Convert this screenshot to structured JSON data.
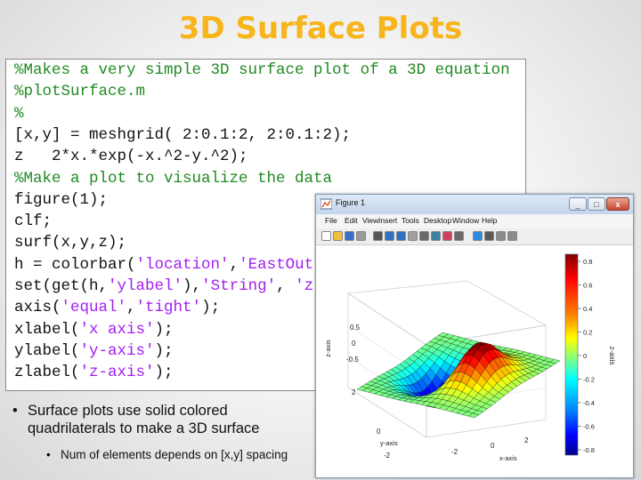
{
  "slide": {
    "title": "3D Surface Plots",
    "code_lines": [
      {
        "parts": [
          {
            "t": "%Makes a very simple 3D surface plot of a 3D equation",
            "c": "comment"
          }
        ]
      },
      {
        "parts": [
          {
            "t": "%plotSurface.m",
            "c": "comment"
          }
        ]
      },
      {
        "parts": [
          {
            "t": "%",
            "c": "comment"
          }
        ]
      },
      {
        "parts": [
          {
            "t": "[x,y] = meshgrid( 2:0.1:2, 2:0.1:2);",
            "c": "code"
          }
        ]
      },
      {
        "parts": [
          {
            "t": "z   2*x.*exp(-x.^2-y.^2);",
            "c": "code"
          }
        ]
      },
      {
        "parts": [
          {
            "t": "%Make a plot to visualize the data",
            "c": "comment"
          }
        ]
      },
      {
        "parts": [
          {
            "t": "figure(1);",
            "c": "code"
          }
        ]
      },
      {
        "parts": [
          {
            "t": "clf;",
            "c": "code"
          }
        ]
      },
      {
        "parts": [
          {
            "t": "surf(x,y,z);",
            "c": "code"
          }
        ]
      },
      {
        "parts": [
          {
            "t": "h = colorbar(",
            "c": "code"
          },
          {
            "t": "'location'",
            "c": "string"
          },
          {
            "t": ",",
            "c": "code"
          },
          {
            "t": "'EastOut",
            "c": "string"
          }
        ]
      },
      {
        "parts": [
          {
            "t": "set(get(h,",
            "c": "code"
          },
          {
            "t": "'ylabel'",
            "c": "string"
          },
          {
            "t": "),",
            "c": "code"
          },
          {
            "t": "'String'",
            "c": "string"
          },
          {
            "t": ", ",
            "c": "code"
          },
          {
            "t": "'z",
            "c": "string"
          }
        ]
      },
      {
        "parts": [
          {
            "t": "axis(",
            "c": "code"
          },
          {
            "t": "'equal'",
            "c": "string"
          },
          {
            "t": ",",
            "c": "code"
          },
          {
            "t": "'tight'",
            "c": "string"
          },
          {
            "t": ");",
            "c": "code"
          }
        ]
      },
      {
        "parts": [
          {
            "t": "xlabel(",
            "c": "code"
          },
          {
            "t": "'x axis'",
            "c": "string"
          },
          {
            "t": ");",
            "c": "code"
          }
        ]
      },
      {
        "parts": [
          {
            "t": "ylabel(",
            "c": "code"
          },
          {
            "t": "'y-axis'",
            "c": "string"
          },
          {
            "t": ");",
            "c": "code"
          }
        ]
      },
      {
        "parts": [
          {
            "t": "zlabel(",
            "c": "code"
          },
          {
            "t": "'z-axis'",
            "c": "string"
          },
          {
            "t": ");",
            "c": "code"
          }
        ]
      }
    ],
    "bullet_1": "Surface plots use solid colored quadrilaterals to make a 3D surface",
    "bullet_2": "Num of elements depends on [x,y] spacing",
    "bullet_symbol": "•"
  },
  "figure_window": {
    "title": "Figure 1",
    "minimize": "_",
    "maximize": "□",
    "close": "x",
    "menus": [
      "File",
      "Edit",
      "View",
      "Insert",
      "Tools",
      "Desktop",
      "Window",
      "Help"
    ],
    "tool_icons": [
      "new-file-icon",
      "open-file-icon",
      "save-icon",
      "print-icon",
      "pointer-icon",
      "zoom-in-icon",
      "zoom-out-icon",
      "pan-icon",
      "rotate-icon",
      "data-cursor-icon",
      "brush-icon",
      "link-icon",
      "colorbar-icon",
      "legend-icon",
      "hide-plot-tools-icon",
      "show-plot-tools-icon"
    ],
    "colorbar": {
      "ticks": [
        "0.8",
        "0.6",
        "0.4",
        "0.2",
        "0",
        "-0.2",
        "-0.4",
        "-0.6",
        "-0.8"
      ],
      "label": "z-axis",
      "colors": [
        "#7f0000",
        "#ff0000",
        "#ff8000",
        "#ffff00",
        "#80ff80",
        "#00ffff",
        "#0080ff",
        "#0000ff",
        "#00008f"
      ]
    },
    "axes": {
      "z_label": "z-axis",
      "z_ticks": [
        "0.5",
        "0",
        "-0.5"
      ],
      "y_label": "y-axis",
      "y_ticks": [
        "2",
        "0",
        "-2"
      ],
      "x_label": "x-axis",
      "x_ticks": [
        "-2",
        "0",
        "2"
      ]
    }
  }
}
